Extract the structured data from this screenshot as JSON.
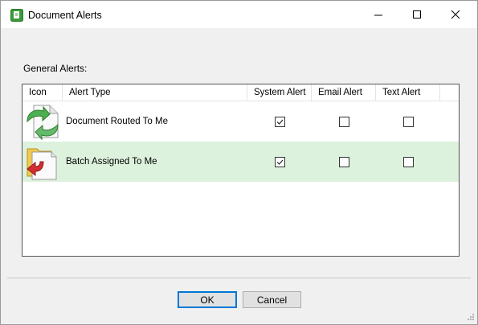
{
  "window": {
    "title": "Document Alerts",
    "app_icon": "document-alerts-app-icon"
  },
  "titlebar_buttons": {
    "minimize": "minimize-icon",
    "maximize": "maximize-icon",
    "close": "close-icon"
  },
  "group_label": "General Alerts:",
  "grid": {
    "columns": [
      "Icon",
      "Alert Type",
      "System Alert",
      "Email Alert",
      "Text Alert"
    ],
    "rows": [
      {
        "icon": "document-routed-icon",
        "alert_type": "Document Routed To Me",
        "system_alert": true,
        "email_alert": false,
        "text_alert": false,
        "selected": false
      },
      {
        "icon": "batch-assigned-icon",
        "alert_type": "Batch Assigned To Me",
        "system_alert": true,
        "email_alert": false,
        "text_alert": false,
        "selected": true
      }
    ]
  },
  "buttons": {
    "ok": "OK",
    "cancel": "Cancel"
  },
  "colors": {
    "selected_row": "#ddf2dd",
    "default_button_border": "#0078d7",
    "window_bg": "#f0f0f0"
  }
}
